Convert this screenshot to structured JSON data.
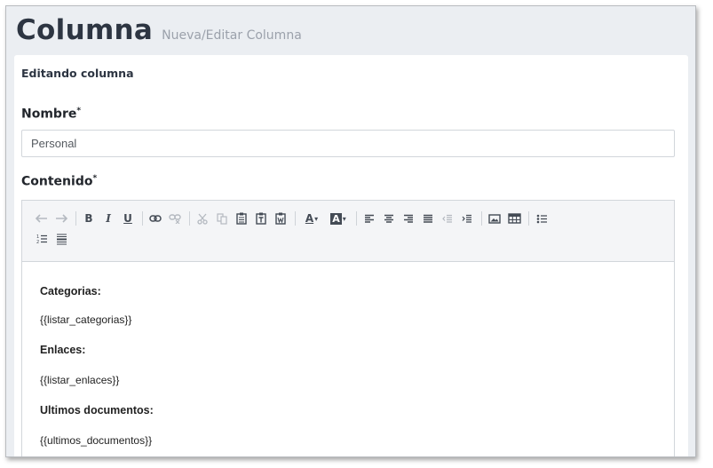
{
  "header": {
    "title": "Columna",
    "subtitle": "Nueva/Editar Columna"
  },
  "card": {
    "heading": "Editando columna"
  },
  "form": {
    "nombre": {
      "label": "Nombre",
      "required_mark": "*",
      "value": "Personal"
    },
    "contenido": {
      "label": "Contenido",
      "required_mark": "*"
    }
  },
  "toolbar": {
    "buttons": [
      "undo-icon",
      "redo-icon",
      "bold-icon",
      "italic-icon",
      "underline-icon",
      "link-icon",
      "unlink-icon",
      "cut-icon",
      "copy-icon",
      "paste-icon",
      "paste-text-icon",
      "paste-word-icon",
      "text-color-icon",
      "background-color-icon",
      "align-left-icon",
      "align-center-icon",
      "align-right-icon",
      "align-justify-icon",
      "outdent-icon",
      "indent-icon",
      "image-icon",
      "table-icon",
      "bullet-list-icon",
      "numbered-list-icon",
      "horizontal-rule-icon"
    ],
    "glyphs": {
      "bold": "B",
      "italic": "I",
      "underline": "U",
      "text_color": "A",
      "bg_color": "A"
    }
  },
  "editor": {
    "lines": [
      {
        "text": "Categorias:",
        "bold": true
      },
      {
        "text": "{{listar_categorias}}",
        "bold": false
      },
      {
        "text": "Enlaces:",
        "bold": true
      },
      {
        "text": "{{listar_enlaces}}",
        "bold": false
      },
      {
        "text": "Ultimos documentos:",
        "bold": true
      },
      {
        "text": "{{ultimos_documentos}}",
        "bold": false
      }
    ]
  }
}
